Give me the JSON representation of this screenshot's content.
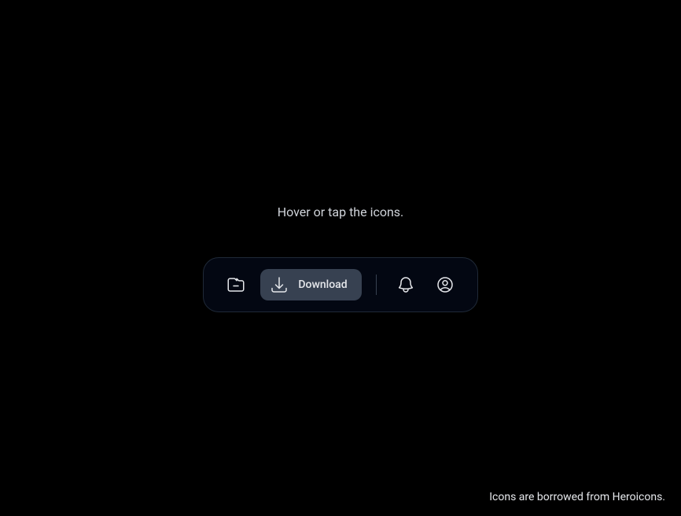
{
  "instruction": "Hover or tap the icons.",
  "toolbar": {
    "items": [
      {
        "icon": "folder-minus",
        "label": "Remove"
      },
      {
        "icon": "arrow-down-tray",
        "label": "Download"
      },
      {
        "icon": "divider"
      },
      {
        "icon": "bell",
        "label": "Notifications"
      },
      {
        "icon": "user-circle",
        "label": "Profile"
      }
    ],
    "hovered_index": 1
  },
  "footer": {
    "credit": "Icons are borrowed from Heroicons."
  }
}
